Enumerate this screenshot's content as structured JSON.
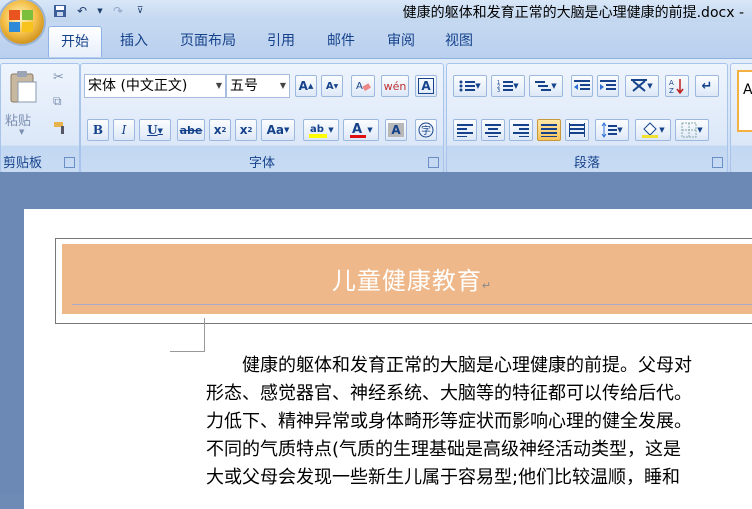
{
  "window": {
    "title": "健康的躯体和发育正常的大脑是心理健康的前提.docx -"
  },
  "tabs": [
    "开始",
    "插入",
    "页面布局",
    "引用",
    "邮件",
    "审阅",
    "视图"
  ],
  "clipboard": {
    "paste_label": "粘贴",
    "group_label": "剪贴板"
  },
  "font": {
    "name": "宋体 (中文正文)",
    "size": "五号",
    "group_label": "字体"
  },
  "paragraph": {
    "group_label": "段落"
  },
  "styles": {
    "preview": "A"
  },
  "document": {
    "title": "儿童健康教育",
    "lines": [
      "　　健康的躯体和发育正常的大脑是心理健康的前提。父母对",
      "形态、感觉器官、神经系统、大脑等的特征都可以传给后代。",
      "力低下、精神异常或身体畸形等症状而影响心理的健全发展。",
      "不同的气质特点(气质的生理基础是高级神经活动类型，这是",
      "大或父母会发现一些新生儿属于容易型;他们比较温顺，睡和"
    ]
  },
  "colors": {
    "ribbon_text": "#15428b",
    "banner": "#efb88a",
    "workspace": "#6b89b4"
  }
}
